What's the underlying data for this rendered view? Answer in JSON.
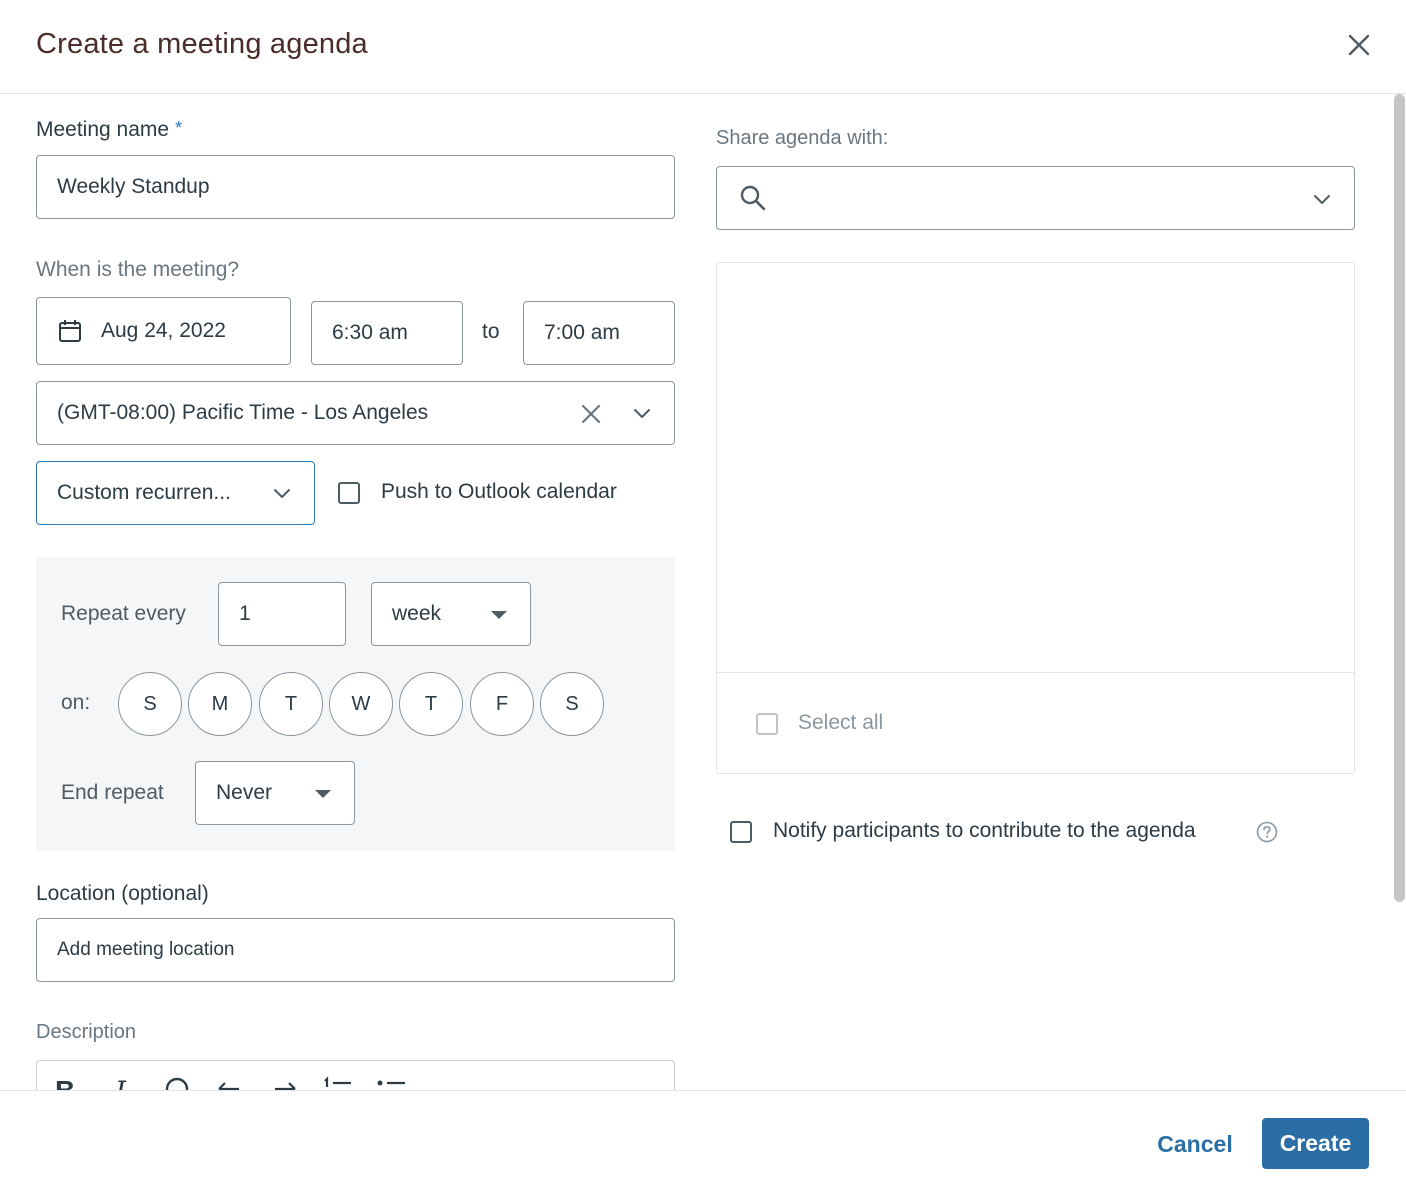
{
  "dialog": {
    "title": "Create a meeting agenda"
  },
  "form": {
    "meeting_name": {
      "label": "Meeting name",
      "required_mark": "*",
      "value": "Weekly Standup"
    },
    "when": {
      "label": "When is the meeting?",
      "date": "Aug 24, 2022",
      "start_time": "6:30 am",
      "to_label": "to",
      "end_time": "7:00 am",
      "timezone": "(GMT-08:00) Pacific Time - Los Angeles"
    },
    "recurrence": {
      "value": "Custom recurren...",
      "push_outlook_label": "Push to Outlook calendar",
      "push_outlook_checked": false
    },
    "custom": {
      "repeat_every_label": "Repeat every",
      "repeat_every_value": "1",
      "unit": "week",
      "on_label": "on:",
      "days": [
        "S",
        "M",
        "T",
        "W",
        "T",
        "F",
        "S"
      ],
      "end_repeat_label": "End repeat",
      "end_repeat_value": "Never"
    },
    "location": {
      "label": "Location (optional)",
      "placeholder": "Add meeting location"
    },
    "description": {
      "label": "Description",
      "toolbar": [
        "bold-icon",
        "italic-icon",
        "link-icon",
        "undo-icon",
        "redo-icon",
        "ordered-list-icon",
        "bullet-list-icon"
      ]
    }
  },
  "share": {
    "label": "Share agenda with:",
    "search_value": "",
    "select_all_label": "Select all",
    "notify_label": "Notify participants to contribute to the agenda",
    "notify_checked": false
  },
  "footer": {
    "cancel_label": "Cancel",
    "create_label": "Create"
  },
  "colors": {
    "accent": "#2b6ea6",
    "title": "#4a2c2a",
    "panel_bg": "#f5f6f7"
  }
}
